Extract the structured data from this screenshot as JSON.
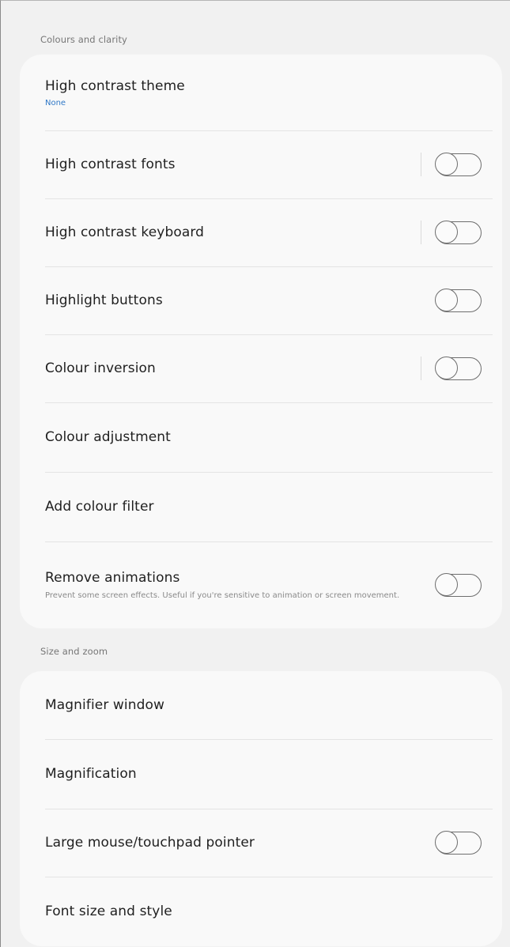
{
  "sections": {
    "colours_and_clarity": {
      "header": "Colours and clarity",
      "items": [
        {
          "title": "High contrast theme",
          "subtitle": "None"
        },
        {
          "title": "High contrast fonts",
          "toggle": false
        },
        {
          "title": "High contrast keyboard",
          "toggle": false
        },
        {
          "title": "Highlight buttons",
          "toggle": false
        },
        {
          "title": "Colour inversion",
          "toggle": false
        },
        {
          "title": "Colour adjustment"
        },
        {
          "title": "Add colour filter"
        },
        {
          "title": "Remove animations",
          "description": "Prevent some screen effects. Useful if you're sensitive to animation or screen movement.",
          "toggle": false
        }
      ]
    },
    "size_and_zoom": {
      "header": "Size and zoom",
      "items": [
        {
          "title": "Magnifier window"
        },
        {
          "title": "Magnification"
        },
        {
          "title": "Large mouse/touchpad pointer",
          "toggle": false
        },
        {
          "title": "Font size and style"
        }
      ]
    }
  },
  "colors": {
    "accent_blue": "#2f78c7",
    "card_background": "#f9f9f9",
    "page_background": "#f1f1f1"
  }
}
